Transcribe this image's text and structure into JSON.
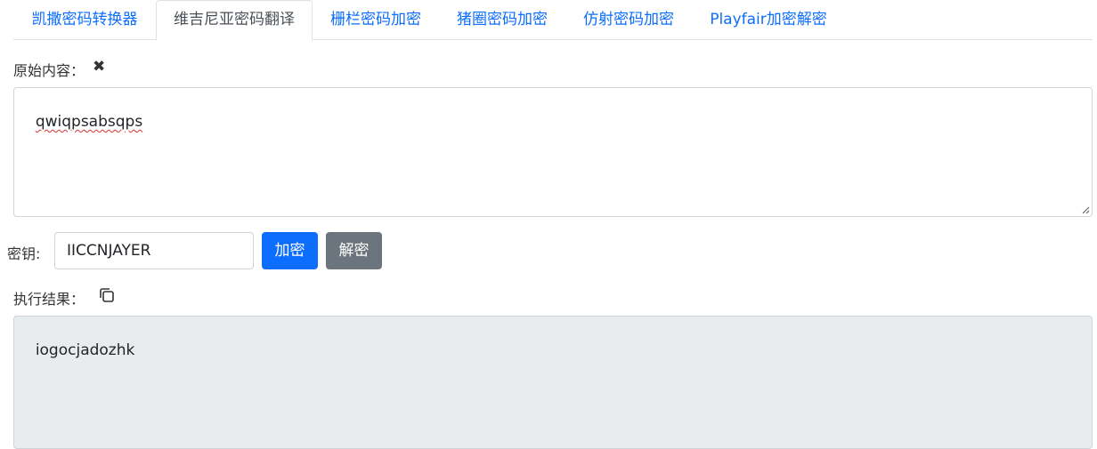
{
  "tabs": [
    {
      "label": "凯撒密码转换器",
      "active": false
    },
    {
      "label": "维吉尼亚密码翻译",
      "active": true
    },
    {
      "label": "栅栏密码加密",
      "active": false
    },
    {
      "label": "猪圈密码加密",
      "active": false
    },
    {
      "label": "仿射密码加密",
      "active": false
    },
    {
      "label": "Playfair加密解密",
      "active": false
    }
  ],
  "input_section": {
    "label": "原始内容：",
    "clear_icon": "close-icon",
    "value": "qwiqpsabsqps"
  },
  "key": {
    "label": "密钥:",
    "value": "IICCNJAYER"
  },
  "buttons": {
    "encrypt": "加密",
    "decrypt": "解密"
  },
  "output_section": {
    "label": "执行结果：",
    "copy_icon": "copy-icon",
    "value": "iogocjadozhk"
  },
  "colors": {
    "link": "#0d6efd",
    "primary": "#0d6efd",
    "secondary": "#6c757d",
    "readonly_bg": "#e9ecef"
  }
}
